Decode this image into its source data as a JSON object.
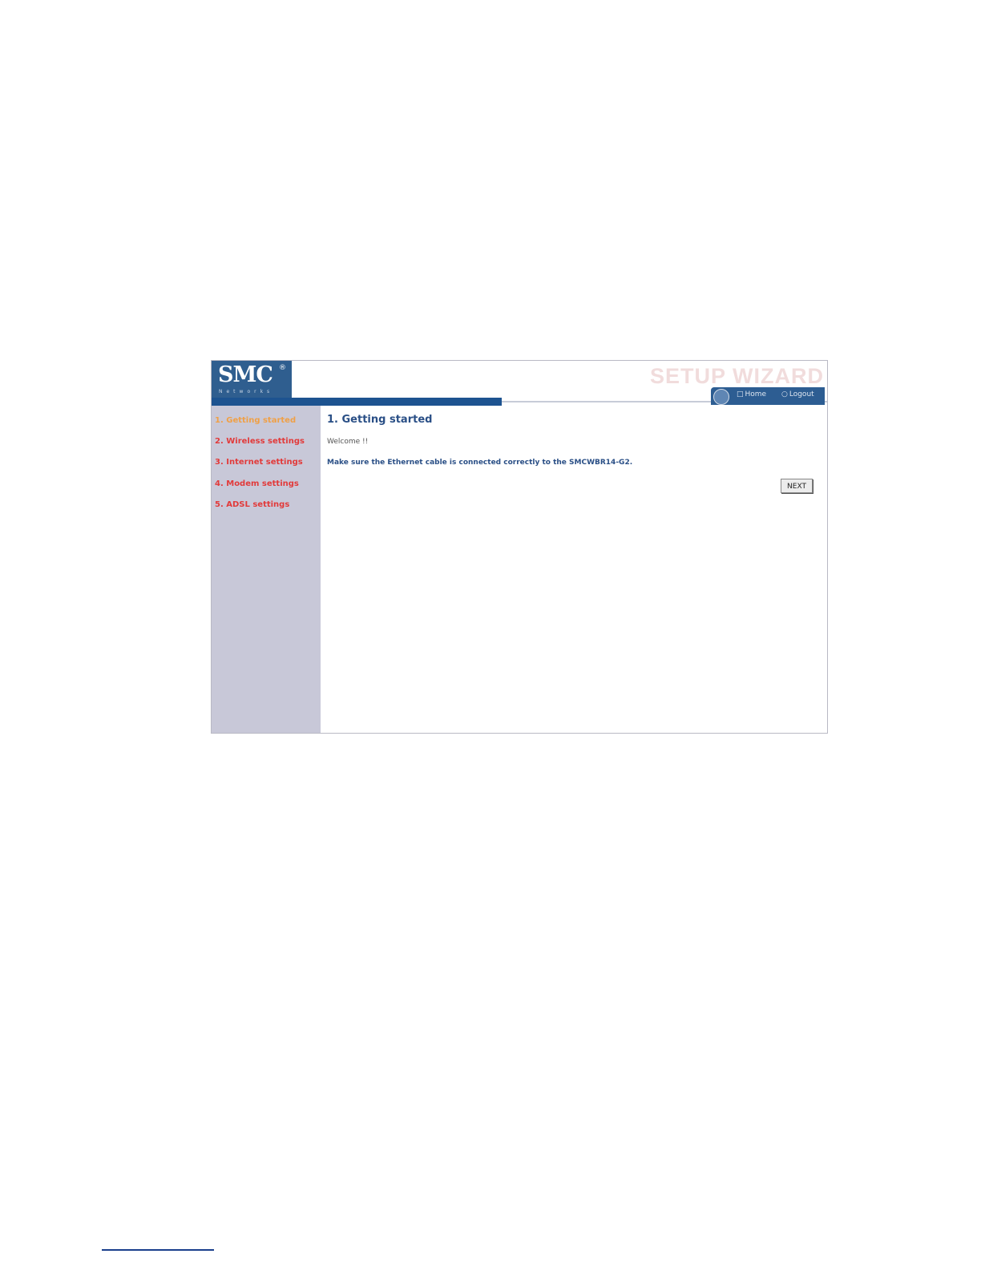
{
  "header": {
    "logo_text": "SMC",
    "logo_reg": "®",
    "logo_sub": "Networks",
    "wizard_title": "SETUP WIZARD",
    "home_label": "Home",
    "logout_label": "Logout"
  },
  "sidebar": {
    "items": [
      {
        "label": "1. Getting started",
        "active": true
      },
      {
        "label": "2. Wireless settings",
        "active": false
      },
      {
        "label": "3. Internet settings",
        "active": false
      },
      {
        "label": "4. Modem settings",
        "active": false
      },
      {
        "label": "5. ADSL settings",
        "active": false
      }
    ]
  },
  "main": {
    "heading": "1. Getting started",
    "welcome": "Welcome !!",
    "instruction": "Make sure the Ethernet cable is connected correctly to the SMCWBR14-G2.",
    "next_label": "NEXT"
  },
  "colors": {
    "brand_blue": "#2f5e8f",
    "sidebar_bg": "#c8c8d8",
    "link_red": "#e23a3a",
    "active_orange": "#f0a046",
    "heading_blue": "#2a4f86"
  }
}
